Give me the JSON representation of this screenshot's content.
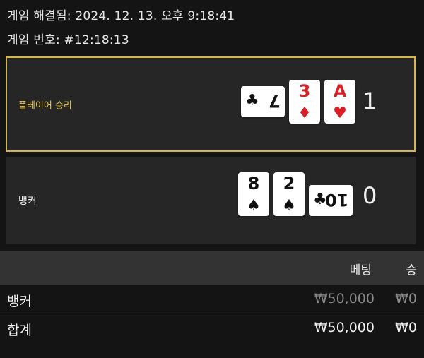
{
  "header": {
    "resolved": "게임 해결됨: 2024. 12. 13. 오후 9:18:41",
    "game_number": "게임 번호: #12:18:13"
  },
  "player": {
    "label": "플레이어 승리",
    "cards": [
      {
        "rank": "7",
        "suit": "♣",
        "color": "black",
        "orientation": "sideways"
      },
      {
        "rank": "3",
        "suit": "♦",
        "color": "red"
      },
      {
        "rank": "A",
        "suit": "♥",
        "color": "red"
      }
    ],
    "score": "1",
    "highlight_color": "#d4b54a"
  },
  "banker": {
    "label": "뱅커",
    "cards": [
      {
        "rank": "8",
        "suit": "♠",
        "color": "black"
      },
      {
        "rank": "2",
        "suit": "♠",
        "color": "black"
      },
      {
        "rank": "10",
        "suit": "♣",
        "color": "black",
        "orientation": "sideways"
      }
    ],
    "score": "0"
  },
  "table": {
    "headers": {
      "bet": "베팅",
      "win": "승"
    },
    "rows": [
      {
        "label": "뱅커",
        "bet": "₩50,000",
        "win": "₩0"
      },
      {
        "label": "합계",
        "bet": "₩50,000",
        "win": "₩0"
      }
    ]
  }
}
